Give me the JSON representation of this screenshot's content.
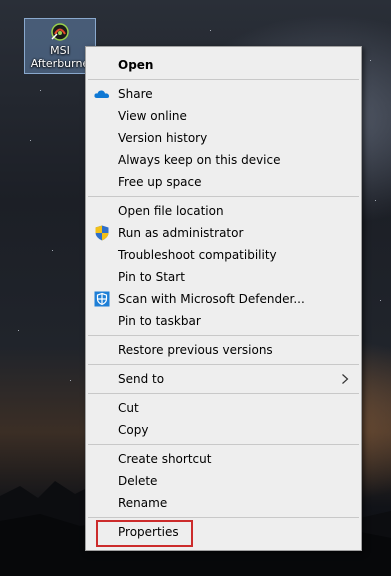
{
  "desktop": {
    "icon": {
      "label_line1": "MSI",
      "label_line2": "Afterburne",
      "icon_name": "msi-afterburner-icon"
    }
  },
  "context_menu": {
    "open": "Open",
    "share": "Share",
    "view_online": "View online",
    "version_history": "Version history",
    "always_keep": "Always keep on this device",
    "free_up_space": "Free up space",
    "open_file_location": "Open file location",
    "run_as_admin": "Run as administrator",
    "troubleshoot": "Troubleshoot compatibility",
    "pin_to_start": "Pin to Start",
    "scan_defender": "Scan with Microsoft Defender...",
    "pin_to_taskbar": "Pin to taskbar",
    "restore_previous": "Restore previous versions",
    "send_to": "Send to",
    "cut": "Cut",
    "copy": "Copy",
    "create_shortcut": "Create shortcut",
    "delete": "Delete",
    "rename": "Rename",
    "properties": "Properties"
  },
  "icons": {
    "share": "onedrive-cloud-icon",
    "run_as_admin": "uac-shield-icon",
    "scan_defender": "defender-shield-icon",
    "send_to": "chevron-right-icon"
  },
  "colors": {
    "menu_background": "#eeeeee",
    "highlight_border": "#cc2b2b",
    "onedrive_blue": "#0f78d4"
  }
}
